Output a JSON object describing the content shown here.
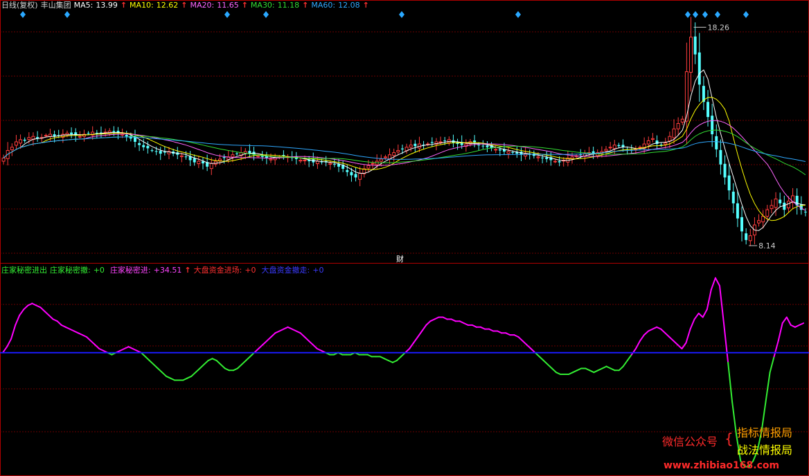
{
  "colors": {
    "up": "#ff3d3d",
    "down": "#54ffff",
    "ma5": "#ffffff",
    "ma10": "#ffff00",
    "ma20": "#ff66ff",
    "ma30": "#33dd33",
    "ma60": "#2fa8ff",
    "pos": "#ff00ff",
    "neg": "#33ee33",
    "zero": "#1a1aff",
    "grid": "#6b0000",
    "sep": "#b00000"
  },
  "main_header": {
    "period": "日线(复权)",
    "stock_name": "丰山集团",
    "ma5_label": "MA5:",
    "ma5_value": "13.99",
    "ma10_label": "MA10:",
    "ma10_value": "12.62",
    "ma20_label": "MA20:",
    "ma20_value": "11.65",
    "ma30_label": "MA30:",
    "ma30_value": "11.18",
    "ma60_label": "MA60:",
    "ma60_value": "12.08",
    "arrow": "↑"
  },
  "sub_header": {
    "ind1_label": "庄家秘密进出",
    "ind2_label": "庄家秘密撤:",
    "ind2_value": "+0",
    "ind3_label": "庄家秘密进:",
    "ind3_value": "+34.51",
    "ind4_label": "大盘资金进场:",
    "ind4_value": "+0",
    "ind5_label": "大盘资金撤走:",
    "ind5_value": "+0",
    "arrow": "↑"
  },
  "finance_marker": "财",
  "watermark": {
    "wechat": "微信公众号",
    "line1": "指标情报局",
    "line2": "战法情报局",
    "url": "www.zhibiao168.com"
  },
  "chart_data": [
    {
      "type": "candlestick",
      "title": "丰山集团",
      "period": "日线(复权)",
      "ylim": [
        7.5,
        19.2
      ],
      "high_label": "18.26",
      "low_label": "8.14",
      "ma_values": {
        "MA5": 13.99,
        "MA10": 12.62,
        "MA20": 11.65,
        "MA30": 11.18,
        "MA60": 12.08
      },
      "candle_count": 192,
      "closes": [
        12.2,
        12.55,
        12.7,
        12.95,
        13.05,
        13.0,
        13.15,
        13.2,
        13.1,
        13.15,
        13.25,
        13.3,
        13.2,
        13.25,
        13.3,
        13.35,
        13.3,
        13.25,
        13.2,
        13.3,
        13.35,
        13.4,
        13.35,
        13.3,
        13.4,
        13.45,
        13.4,
        13.35,
        13.3,
        13.2,
        13.1,
        12.95,
        12.8,
        12.7,
        12.65,
        12.55,
        12.5,
        12.4,
        12.45,
        12.5,
        12.4,
        12.35,
        12.3,
        12.25,
        12.1,
        12.0,
        12.05,
        11.95,
        11.8,
        11.95,
        12.05,
        12.15,
        12.2,
        12.25,
        12.35,
        12.4,
        12.45,
        12.5,
        12.4,
        12.35,
        12.3,
        12.25,
        12.2,
        12.15,
        12.2,
        12.25,
        12.3,
        12.25,
        12.2,
        12.15,
        12.1,
        12.1,
        12.05,
        12.0,
        12.05,
        12.0,
        12.0,
        11.95,
        11.9,
        11.8,
        11.7,
        11.55,
        11.4,
        11.3,
        11.5,
        11.7,
        11.85,
        11.95,
        12.05,
        12.15,
        12.25,
        12.35,
        12.45,
        12.55,
        12.6,
        12.7,
        12.8,
        12.75,
        12.85,
        12.8,
        12.85,
        12.9,
        12.95,
        12.95,
        13.0,
        13.05,
        12.9,
        12.85,
        12.8,
        12.85,
        12.95,
        12.9,
        12.8,
        12.75,
        12.7,
        12.65,
        12.6,
        12.55,
        12.5,
        12.5,
        12.45,
        12.4,
        12.35,
        12.4,
        12.35,
        12.3,
        12.25,
        12.2,
        12.15,
        12.1,
        12.05,
        12.0,
        12.1,
        12.2,
        12.25,
        12.3,
        12.35,
        12.4,
        12.45,
        12.4,
        12.45,
        12.5,
        12.6,
        12.7,
        12.8,
        12.75,
        12.7,
        12.6,
        12.55,
        12.6,
        12.7,
        12.85,
        13.0,
        13.1,
        12.85,
        12.8,
        12.9,
        13.2,
        13.55,
        13.8,
        14.0,
        16.2,
        17.8,
        17.0,
        15.6,
        14.8,
        14.1,
        13.3,
        12.6,
        11.9,
        11.3,
        10.7,
        10.1,
        9.4,
        8.8,
        8.4,
        8.6,
        9.1,
        9.3,
        9.5,
        9.8,
        10.0,
        10.3,
        10.1,
        9.8,
        10.2,
        10.45,
        10.0,
        9.8,
        9.7
      ]
    },
    {
      "type": "line",
      "title": "庄家秘密进出",
      "series": [
        {
          "name": "庄家秘密进",
          "current": 34.51
        },
        {
          "name": "庄家秘密撤",
          "current": 0
        }
      ],
      "zero_line": 0,
      "ylim": [
        -62,
        40
      ],
      "values": [
        0,
        3,
        7,
        14,
        19,
        22,
        24,
        25,
        24,
        23,
        21,
        19,
        17,
        16,
        14,
        13,
        12,
        11,
        10,
        9,
        8,
        6,
        4,
        2,
        1,
        0,
        -1,
        0,
        1,
        2,
        3,
        2,
        1,
        0,
        -2,
        -4,
        -6,
        -8,
        -10,
        -12,
        -13,
        -14,
        -14,
        -14,
        -13,
        -12,
        -10,
        -8,
        -6,
        -4,
        -3,
        -4,
        -6,
        -8,
        -9,
        -9,
        -8,
        -6,
        -4,
        -2,
        0,
        2,
        4,
        6,
        8,
        10,
        11,
        12,
        13,
        12,
        11,
        10,
        8,
        6,
        4,
        2,
        1,
        0,
        -1,
        -1,
        0,
        -1,
        -1,
        -1,
        0,
        -1,
        -1,
        -1,
        -2,
        -2,
        -2,
        -3,
        -4,
        -5,
        -4,
        -2,
        0,
        2,
        5,
        8,
        11,
        14,
        16,
        17,
        18,
        18,
        17,
        17,
        16,
        16,
        15,
        14,
        14,
        13,
        13,
        12,
        12,
        11,
        11,
        10,
        10,
        9,
        9,
        8,
        6,
        4,
        2,
        0,
        -2,
        -4,
        -6,
        -8,
        -10,
        -11,
        -11,
        -11,
        -10,
        -9,
        -8,
        -8,
        -9,
        -10,
        -9,
        -8,
        -7,
        -8,
        -9,
        -9,
        -7,
        -4,
        -1,
        2,
        6,
        9,
        11,
        12,
        13,
        12,
        10,
        8,
        6,
        4,
        2,
        5,
        12,
        17,
        20,
        18,
        22,
        32,
        38,
        34,
        15,
        -5,
        -25,
        -42,
        -55,
        -58,
        -58,
        -55,
        -50,
        -40,
        -25,
        -10,
        -2,
        6,
        15,
        18,
        14,
        13,
        14,
        15
      ]
    }
  ]
}
